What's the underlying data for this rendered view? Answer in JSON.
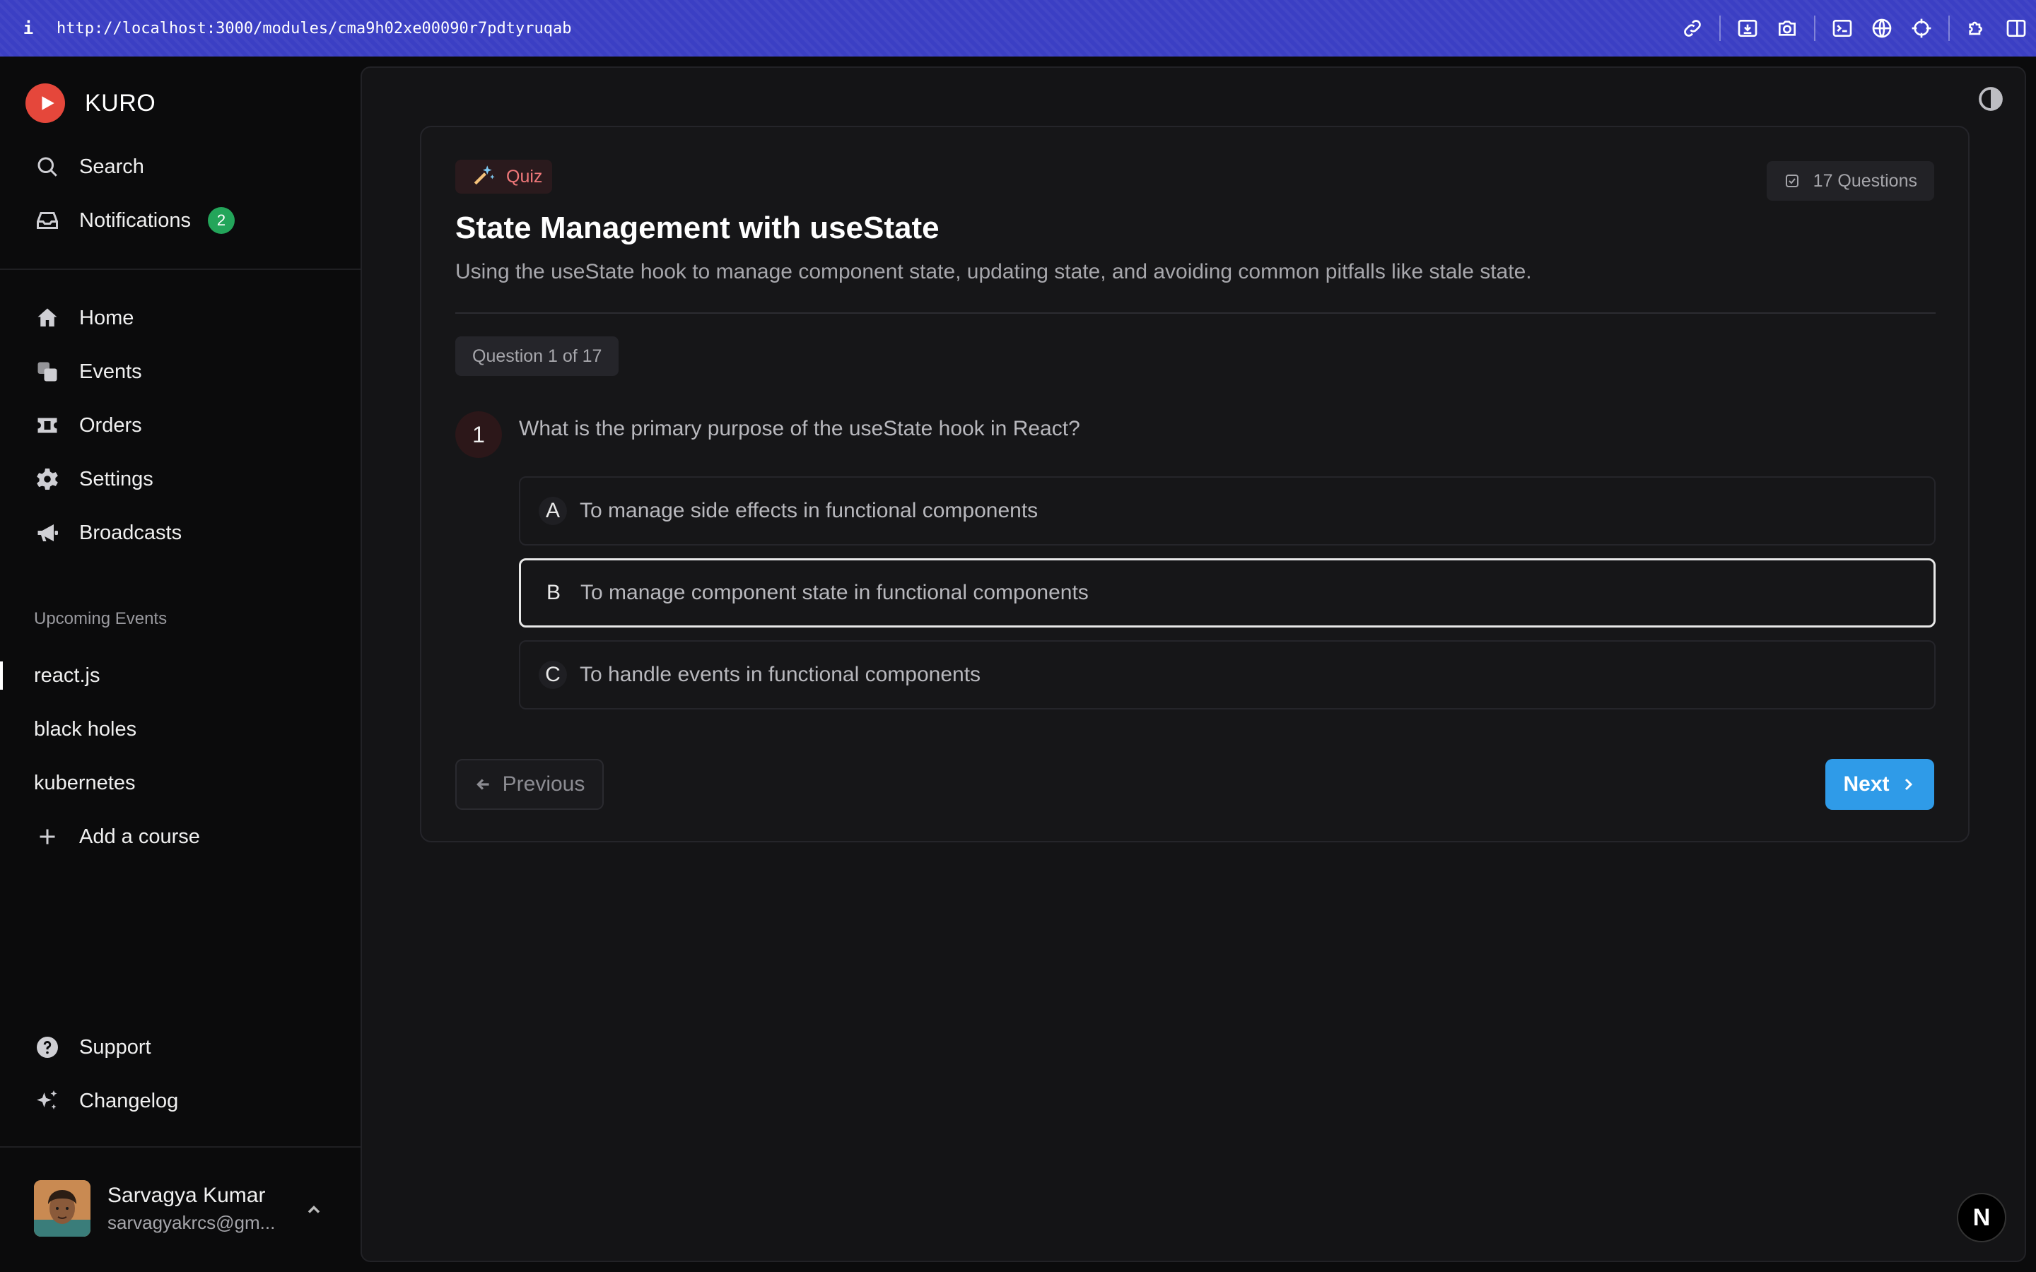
{
  "browser": {
    "info_label": "i",
    "url": "http://localhost:3000/modules/cma9h02xe00090r7pdtyruqab",
    "tools": [
      "link-icon",
      "download-icon",
      "camera-icon",
      "terminal-icon",
      "globe-icon",
      "crosshair-icon",
      "puzzle-icon",
      "sidebar-icon"
    ]
  },
  "sidebar": {
    "brand": "KURO",
    "search_label": "Search",
    "notifications_label": "Notifications",
    "notifications_count": "2",
    "nav": [
      {
        "label": "Home",
        "icon": "home-icon"
      },
      {
        "label": "Events",
        "icon": "events-icon"
      },
      {
        "label": "Orders",
        "icon": "ticket-icon"
      },
      {
        "label": "Settings",
        "icon": "gear-icon"
      },
      {
        "label": "Broadcasts",
        "icon": "megaphone-icon"
      }
    ],
    "upcoming_label": "Upcoming Events",
    "courses": [
      "react.js",
      "black holes",
      "kubernetes"
    ],
    "add_course_label": "Add a course",
    "support_label": "Support",
    "changelog_label": "Changelog",
    "user": {
      "name": "Sarvagya Kumar",
      "email": "sarvagyakrcs@gm..."
    }
  },
  "quiz": {
    "chip_label": "Quiz",
    "question_count": "17 Questions",
    "title": "State Management with useState",
    "description": "Using the useState hook to manage component state, updating state, and avoiding common pitfalls like stale state.",
    "progress": "Question 1 of 17",
    "number": "1",
    "question": "What is the primary purpose of the useState hook in React?",
    "options": [
      {
        "letter": "A",
        "text": "To manage side effects in functional components"
      },
      {
        "letter": "B",
        "text": "To manage component state in functional components"
      },
      {
        "letter": "C",
        "text": "To handle events in functional components"
      }
    ],
    "selected": "B",
    "prev_label": "Previous",
    "next_label": "Next"
  },
  "colors": {
    "accent": "#2f9be8",
    "brand": "#e5473b",
    "quiz_chip": "#f0787a",
    "badge": "#23a55a"
  },
  "dev_badge": "N"
}
